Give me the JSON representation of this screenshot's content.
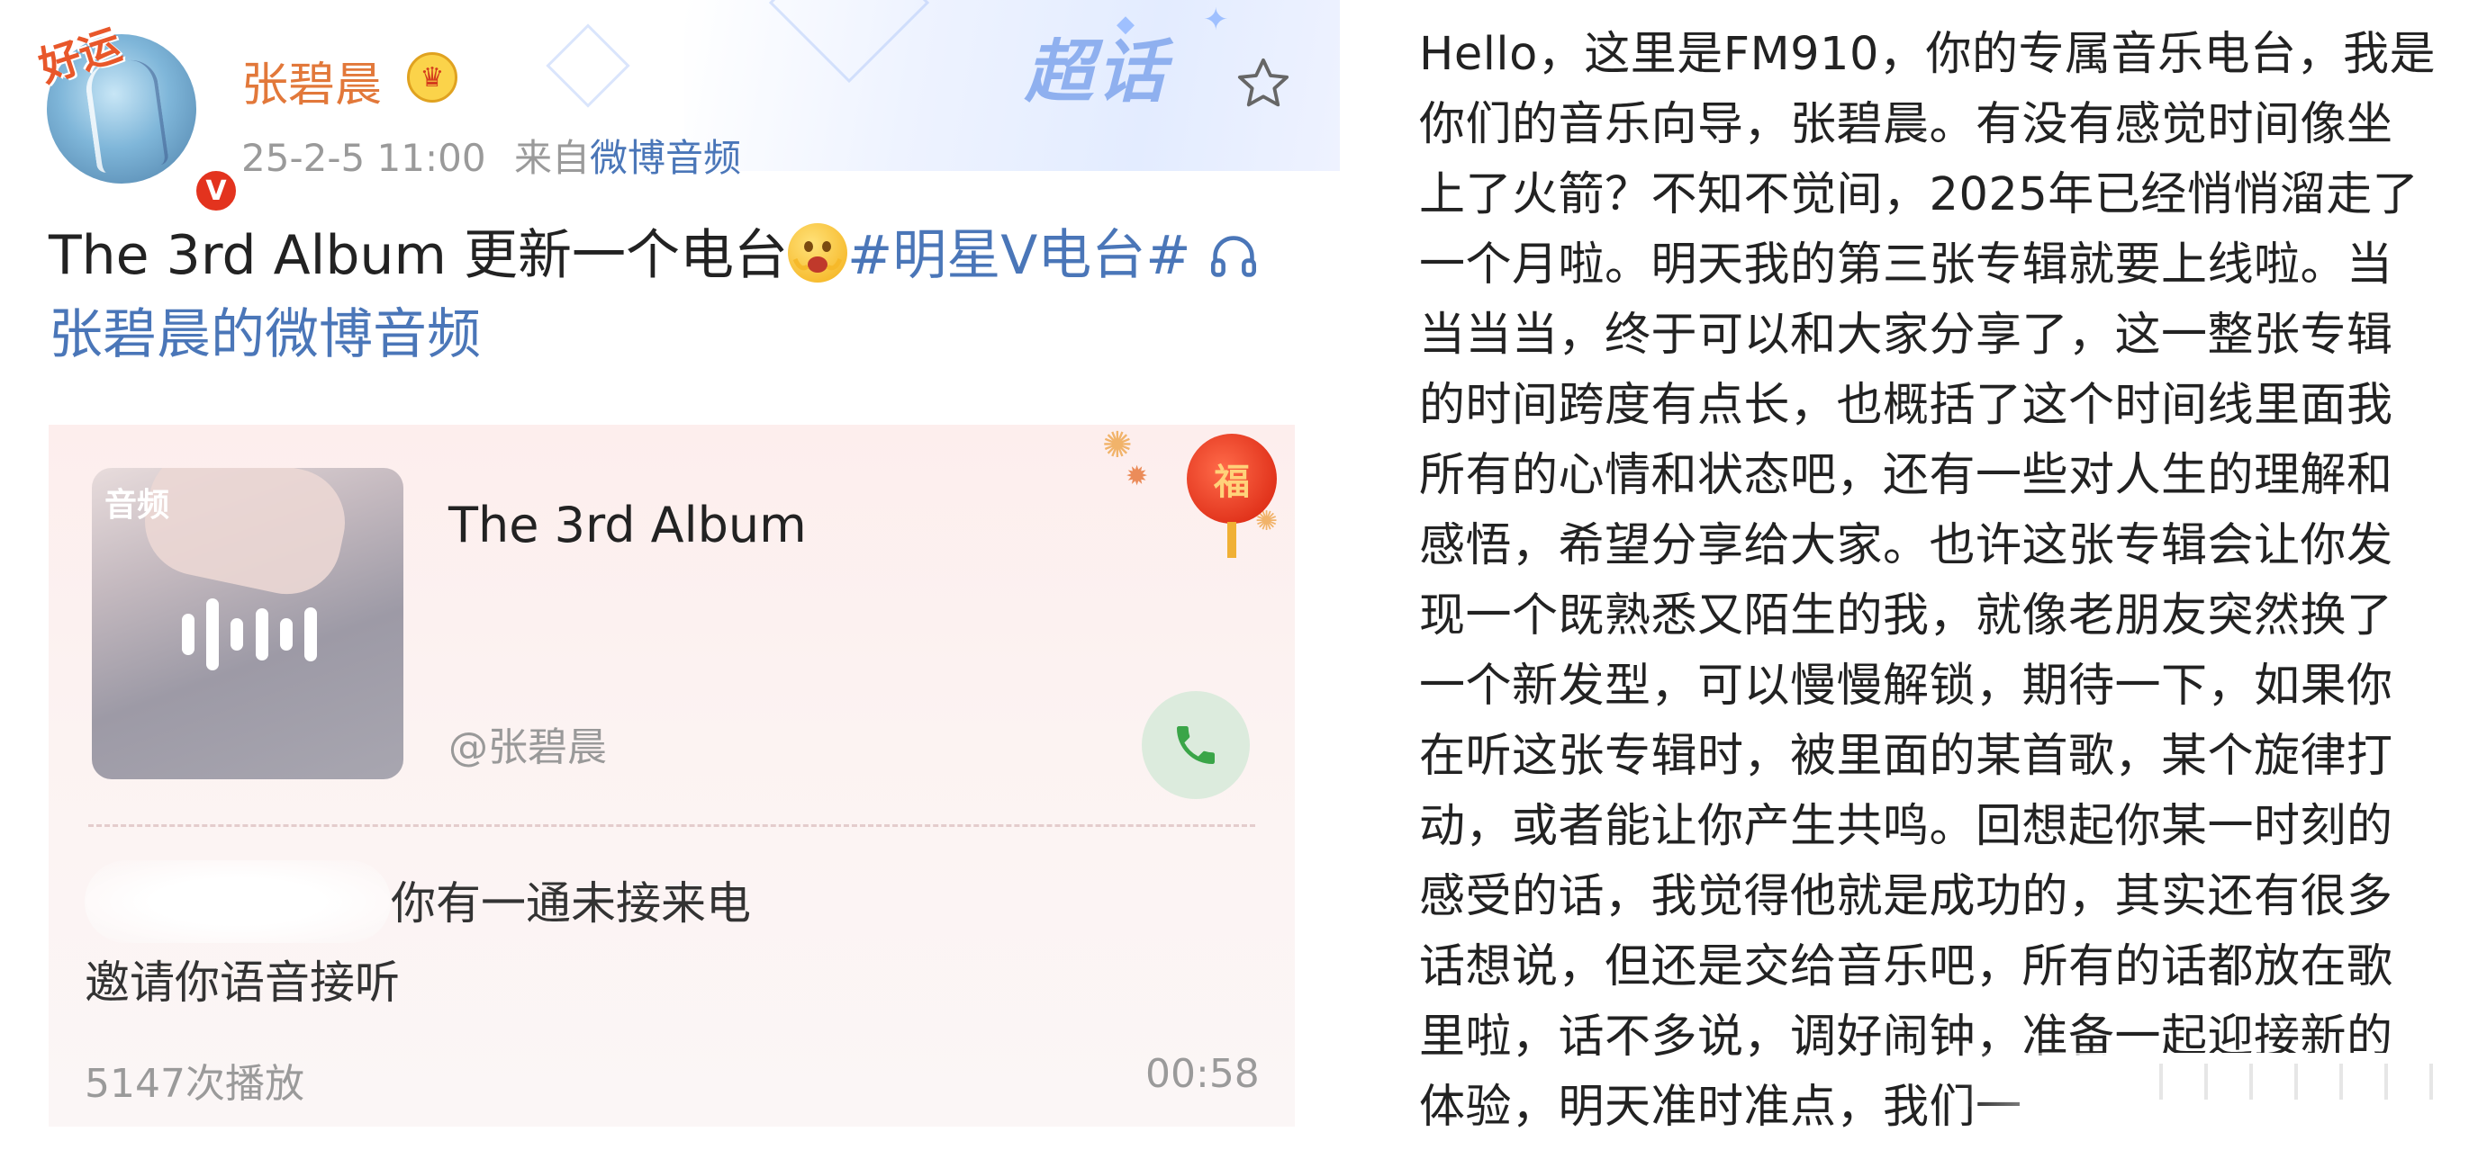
{
  "post": {
    "username": "张碧晨",
    "meta_time": "25-2-5 11:00",
    "meta_from_prefix": "来自",
    "meta_source": "微博音频",
    "chaohua_badge": "超话",
    "avatar_sticker": "好运",
    "verified_badge": "V",
    "text_part1": "The 3rd Album 更新一个电台",
    "text_tag": "#明星V电台#",
    "text_link": "张碧晨的微博音频"
  },
  "audio_card": {
    "cover_label": "音频",
    "title": "The 3rd Album",
    "artist": "@张碧晨",
    "missed_call": "你有一通未接来电",
    "invite": "邀请你语音接听",
    "plays": "5147次播放",
    "duration": "00:58",
    "lantern_char": "福"
  },
  "transcript": {
    "lines": [
      "Hello，这里是FM910，你的专属音乐电台，我是",
      "你们的音乐向导，张碧晨。有没有感觉时间像坐",
      "上了火箭？不知不觉间，2025年已经悄悄溜走了",
      "一个月啦。明天我的第三张专辑就要上线啦。当",
      "当当当，终于可以和大家分享了，这一整张专辑",
      "的时间跨度有点长，也概括了这个时间线里面我",
      "所有的心情和状态吧，还有一些对人生的理解和",
      "感悟，希望分享给大家。也许这张专辑会让你发",
      "现一个既熟悉又陌生的我，就像老朋友突然换了",
      "一个新发型，可以慢慢解锁，期待一下，如果你",
      "在听这张专辑时，被里面的某首歌，某个旋律打",
      "动，或者能让你产生共鸣。回想起你某一时刻的",
      "感受的话，我觉得他就是成功的，其实还有很多",
      "话想说，但还是交给音乐吧，所有的话都放在歌",
      "里啦，话不多说，调好闹钟，准备一起迎接新的",
      "体验，明天准时准点，我们一"
    ]
  },
  "colors": {
    "username": "#e2783a",
    "link": "#4a76b8",
    "meta": "#9a9a9a",
    "call_green": "#3aa548",
    "badge_red": "#e3331e"
  },
  "icons": [
    "star-icon",
    "crown-icon",
    "verified-icon",
    "emoji-icon",
    "headset-icon",
    "phone-icon",
    "waveform-icon",
    "lantern-icon"
  ]
}
